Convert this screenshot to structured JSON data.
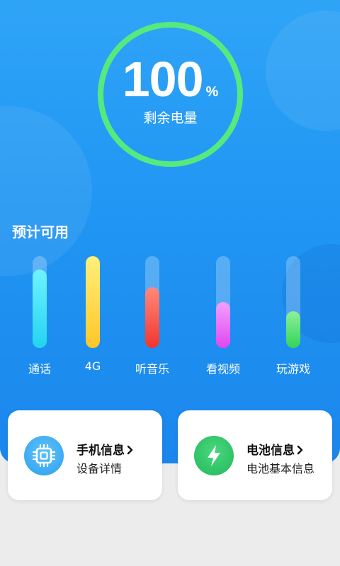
{
  "battery": {
    "percent_value": "100",
    "percent_unit": "%",
    "label": "剩余电量"
  },
  "estimate": {
    "title": "预计可用",
    "bars": [
      {
        "label": "通话",
        "level": 0.85,
        "color_top": "#6ff3ff",
        "color_bottom": "#22d3f0"
      },
      {
        "label": "4G",
        "level": 1.0,
        "color_top": "#fff07a",
        "color_bottom": "#ffc629"
      },
      {
        "label": "听音乐",
        "level": 0.66,
        "color_top": "#ff8a7a",
        "color_bottom": "#f2342f"
      },
      {
        "label": "看视频",
        "level": 0.5,
        "color_top": "#f2a0ff",
        "color_bottom": "#e046ee"
      },
      {
        "label": "玩游戏",
        "level": 0.4,
        "color_top": "#8cf09a",
        "color_bottom": "#33d35a"
      }
    ]
  },
  "cards": {
    "phone_info": {
      "title": "手机信息",
      "subtitle": "设备详情",
      "icon": "chip-icon",
      "icon_color": "#3aaef2"
    },
    "battery_info": {
      "title": "电池信息",
      "subtitle": "电池基本信息",
      "icon": "lightning-icon",
      "icon_color": "#2fc46a"
    }
  },
  "colors": {
    "background_blue": "#2196f3",
    "ring_green": "#57e97e",
    "page_gray": "#ececec"
  }
}
